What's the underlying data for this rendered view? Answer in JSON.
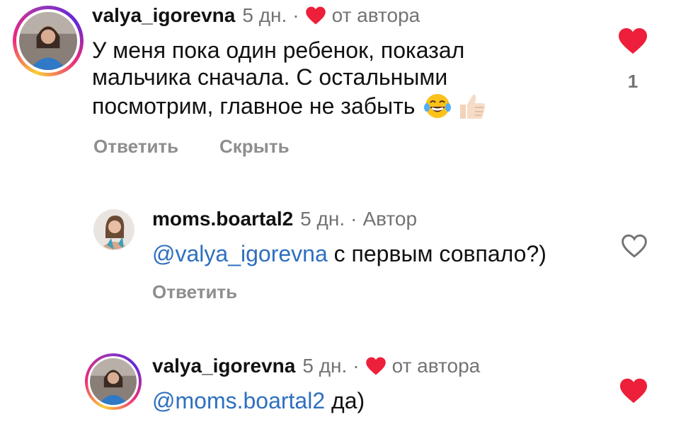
{
  "comments": [
    {
      "username": "valya_igorevna",
      "time": "5 дн.",
      "separator": "·",
      "author_badge": "от автора",
      "text_lines": [
        "У меня пока один ребенок, показал",
        "мальчика сначала. С остальными",
        "посмотрим, главное не забыть"
      ],
      "emoji": [
        "face-with-tears-of-joy",
        "thumbs-up"
      ],
      "actions": [
        "Ответить",
        "Скрыть"
      ],
      "liked": true,
      "like_count": "1"
    },
    {
      "username": "moms.boartal2",
      "time": "5 дн.",
      "separator": "·",
      "author_badge": "Автор",
      "mention": "@valya_igorevna",
      "text": " с первым совпало?)",
      "actions": [
        "Ответить"
      ],
      "liked": false
    },
    {
      "username": "valya_igorevna",
      "time": "5 дн.",
      "separator": "·",
      "author_badge": "от автора",
      "mention": "@moms.boartal2",
      "text": " да)",
      "liked": true
    }
  ],
  "colors": {
    "like_red": "#ed1f3a",
    "mention_blue": "#2e6fbf",
    "meta_gray": "#737373"
  }
}
